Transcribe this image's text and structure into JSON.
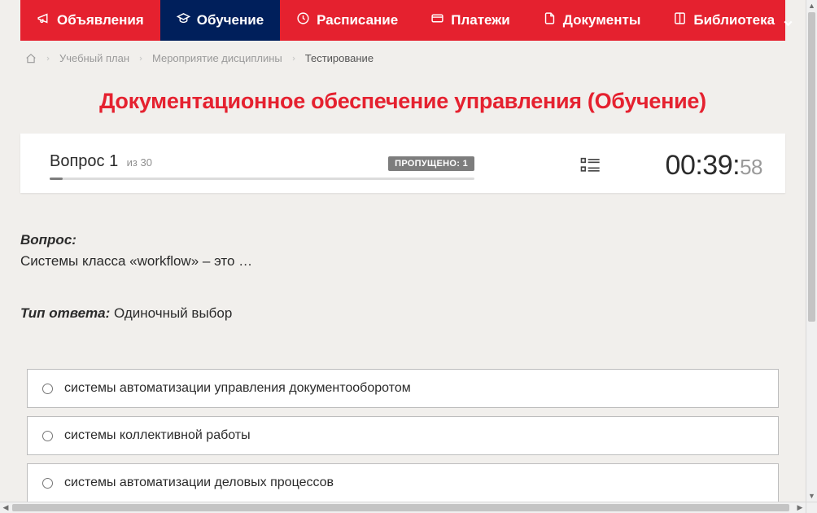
{
  "nav": {
    "items": [
      {
        "label": "Объявления",
        "icon": "megaphone-icon",
        "active": false
      },
      {
        "label": "Обучение",
        "icon": "graduation-icon",
        "active": true
      },
      {
        "label": "Расписание",
        "icon": "clock-icon",
        "active": false
      },
      {
        "label": "Платежи",
        "icon": "card-icon",
        "active": false
      },
      {
        "label": "Документы",
        "icon": "document-icon",
        "active": false
      },
      {
        "label": "Библиотека",
        "icon": "book-icon",
        "active": false,
        "dropdown": true
      }
    ]
  },
  "breadcrumb": {
    "items": [
      {
        "label": "Учебный план"
      },
      {
        "label": "Мероприятие дисциплины"
      }
    ],
    "current": "Тестирование"
  },
  "page_title": "Документационное обеспечение управления (Обучение)",
  "status": {
    "question_label": "Вопрос 1",
    "question_total": "из 30",
    "skipped_badge": "ПРОПУЩЕНО: 1",
    "progress_percent": 3,
    "timer_main": "00:39:",
    "timer_seconds": "58"
  },
  "question": {
    "head_label": "Вопрос:",
    "text": "Системы класса «workflow» – это …",
    "answer_type_label": "Тип ответа:",
    "answer_type_value": "Одиночный выбор"
  },
  "answers": [
    {
      "text": "системы автоматизации управления документооборотом"
    },
    {
      "text": "системы коллективной работы"
    },
    {
      "text": "системы автоматизации деловых процессов"
    }
  ]
}
